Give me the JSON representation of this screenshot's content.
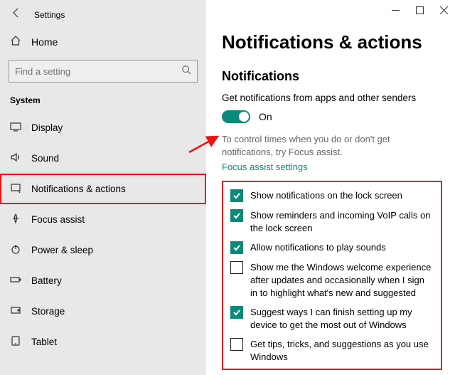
{
  "app_title": "Settings",
  "home_label": "Home",
  "search_placeholder": "Find a setting",
  "section_label": "System",
  "nav": [
    {
      "label": "Display"
    },
    {
      "label": "Sound"
    },
    {
      "label": "Notifications & actions"
    },
    {
      "label": "Focus assist"
    },
    {
      "label": "Power & sleep"
    },
    {
      "label": "Battery"
    },
    {
      "label": "Storage"
    },
    {
      "label": "Tablet"
    }
  ],
  "page_title": "Notifications & actions",
  "subhead": "Notifications",
  "desc": "Get notifications from apps and other senders",
  "toggle": {
    "state": "On"
  },
  "help": "To control times when you do or don't get notifications, try Focus assist.",
  "link": "Focus assist settings",
  "checks": [
    {
      "checked": true,
      "label": "Show notifications on the lock screen"
    },
    {
      "checked": true,
      "label": "Show reminders and incoming VoIP calls on the lock screen"
    },
    {
      "checked": true,
      "label": "Allow notifications to play sounds"
    },
    {
      "checked": false,
      "label": "Show me the Windows welcome experience after updates and occasionally when I sign in to highlight what's new and suggested"
    },
    {
      "checked": true,
      "label": "Suggest ways I can finish setting up my device to get the most out of Windows"
    },
    {
      "checked": false,
      "label": "Get tips, tricks, and suggestions as you use Windows"
    }
  ],
  "colors": {
    "accent": "#0b8a7a",
    "highlight": "#e11"
  }
}
